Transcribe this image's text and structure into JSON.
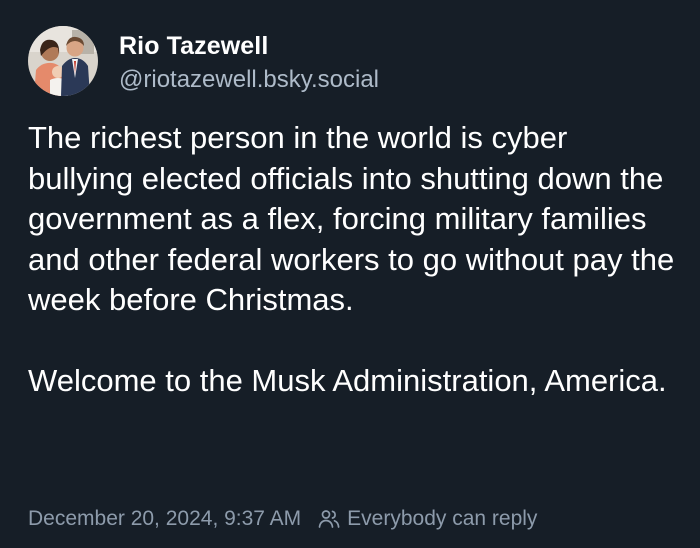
{
  "author": {
    "display_name": "Rio Tazewell",
    "handle": "@riotazewell.bsky.social",
    "avatar_icon": "profile-photo"
  },
  "post": {
    "paragraphs": [
      "The richest person in the world is cyber bullying elected officials into shutting down the government as a flex, forcing military families and other federal workers to go without pay the week before Christmas.",
      "Welcome to the Musk Administration, America."
    ]
  },
  "meta": {
    "timestamp": "December 20, 2024, 9:37 AM",
    "reply_icon": "people-icon",
    "reply_setting": "Everybody can reply"
  },
  "colors": {
    "background": "#161e27",
    "text": "#ffffff",
    "handle": "#aebbc9",
    "meta": "#8d9bab"
  }
}
